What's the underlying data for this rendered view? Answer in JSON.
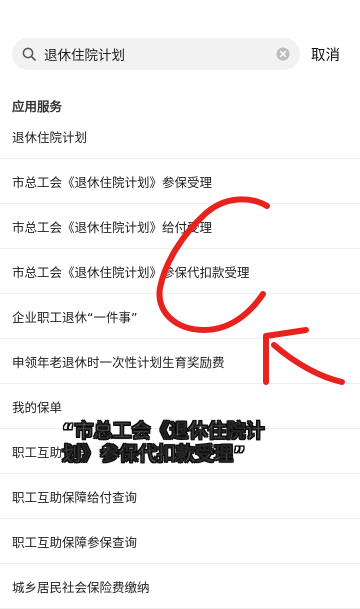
{
  "search": {
    "query": "退休住院计划",
    "cancel_label": "取消"
  },
  "section": {
    "title": "应用服务"
  },
  "results": [
    "退休住院计划",
    "市总工会《退休住院计划》参保受理",
    "市总工会《退休住院计划》给付受理",
    "市总工会《退休住院计划》参保代扣款受理",
    "企业职工退休“一件事”",
    "申领年老退休时一次性计划生育奖励费",
    "我的保单",
    "职工互助保障",
    "职工互助保障给付查询",
    "职工互助保障参保查询",
    "城乡居民社会保险费缴纳"
  ],
  "caption": {
    "line1": "“市总工会《退休住院计",
    "line2": "划》参保代扣款受理”"
  },
  "colors": {
    "annotation_red": "#e8231f"
  }
}
